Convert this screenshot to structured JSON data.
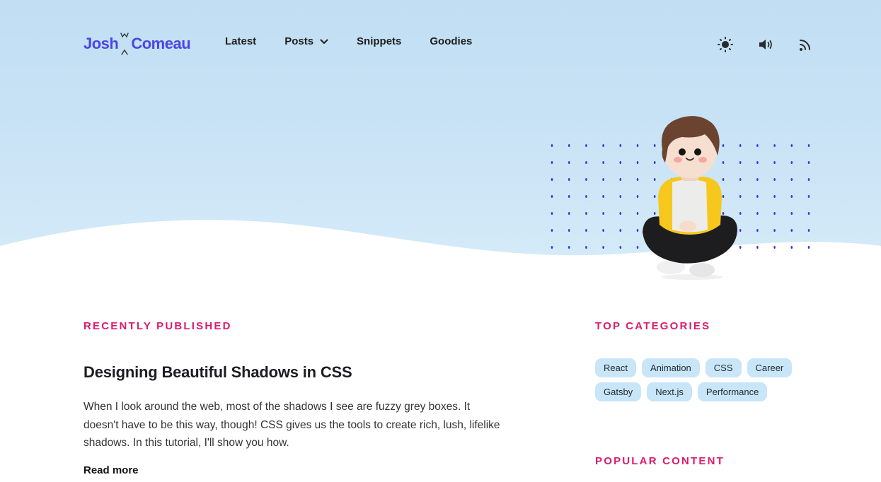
{
  "logo": {
    "first": "Josh",
    "last": "Comeau"
  },
  "nav": [
    {
      "label": "Latest"
    },
    {
      "label": "Posts",
      "has_dropdown": true
    },
    {
      "label": "Snippets"
    },
    {
      "label": "Goodies"
    }
  ],
  "header_icons": [
    "sun-icon",
    "speaker-icon",
    "rss-icon"
  ],
  "colors": {
    "brand": "#4a47e6",
    "accent": "#d91c6f",
    "sky": "#c1def3",
    "tag_bg": "#c9e5f8"
  },
  "recent": {
    "label": "RECENTLY PUBLISHED",
    "post": {
      "title": "Designing Beautiful Shadows in CSS",
      "excerpt": "When I look around the web, most of the shadows I see are fuzzy grey boxes. It doesn't have to be this way, though! CSS gives us the tools to create rich, lush, lifelike shadows. In this tutorial, I'll show you how.",
      "read_more": "Read more"
    }
  },
  "categories": {
    "label": "TOP CATEGORIES",
    "tags": [
      "React",
      "Animation",
      "CSS",
      "Career",
      "Gatsby",
      "Next.js",
      "Performance"
    ]
  },
  "popular": {
    "label": "POPULAR CONTENT"
  }
}
